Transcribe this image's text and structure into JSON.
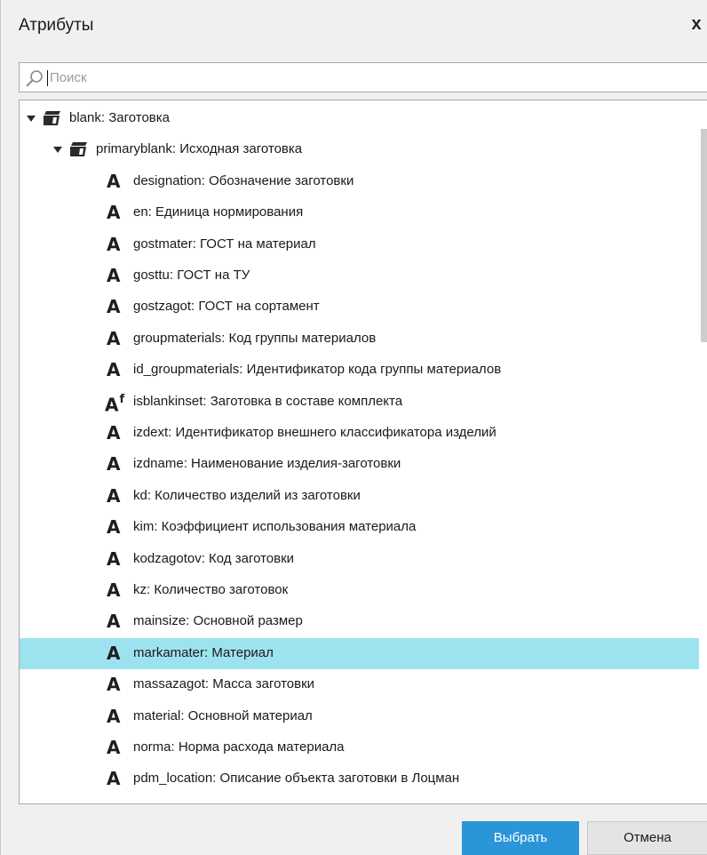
{
  "dialog": {
    "title": "Атрибуты",
    "close_label": "x"
  },
  "search": {
    "placeholder": "Поиск",
    "value": ""
  },
  "tree": {
    "items": [
      {
        "label": "blank: Заготовка",
        "type": "group"
      },
      {
        "label": "primaryblank: Исходная заготовка",
        "type": "group"
      },
      {
        "label": "designation: Обозначение заготовки",
        "type": "attr"
      },
      {
        "label": "en: Единица нормирования",
        "type": "attr"
      },
      {
        "label": "gostmater: ГОСТ на материал",
        "type": "attr"
      },
      {
        "label": "gosttu: ГОСТ на ТУ",
        "type": "attr"
      },
      {
        "label": "gostzagot: ГОСТ на сортамент",
        "type": "attr"
      },
      {
        "label": "groupmaterials: Код группы материалов",
        "type": "attr"
      },
      {
        "label": "id_groupmaterials: Идентификатор кода группы материалов",
        "type": "attr"
      },
      {
        "label": "isblankinset: Заготовка в составе комплекта",
        "type": "attr-formula"
      },
      {
        "label": "izdext: Идентификатор внешнего классификатора изделий",
        "type": "attr"
      },
      {
        "label": "izdname: Наименование изделия-заготовки",
        "type": "attr"
      },
      {
        "label": "kd: Количество изделий из заготовки",
        "type": "attr"
      },
      {
        "label": "kim: Коэффициент использования материала",
        "type": "attr"
      },
      {
        "label": "kodzagotov: Код заготовки",
        "type": "attr"
      },
      {
        "label": "kz: Количество заготовок",
        "type": "attr"
      },
      {
        "label": "mainsize: Основной размер",
        "type": "attr"
      },
      {
        "label": "markamater: Материал",
        "type": "attr",
        "selected": true
      },
      {
        "label": "massazagot: Масса заготовки",
        "type": "attr"
      },
      {
        "label": "material: Основной материал",
        "type": "attr"
      },
      {
        "label": "norma: Норма расхода материала",
        "type": "attr"
      },
      {
        "label": "pdm_location: Описание объекта заготовки в Лоцман",
        "type": "attr"
      }
    ],
    "attr_icon_letter": "A",
    "formula_icon_suffix": "f",
    "selection_color": "#9de3ef"
  },
  "buttons": {
    "select_label": "Выбрать",
    "cancel_label": "Отмена"
  },
  "colors": {
    "accent": "#2b95d9",
    "selection": "#9de3ef"
  }
}
